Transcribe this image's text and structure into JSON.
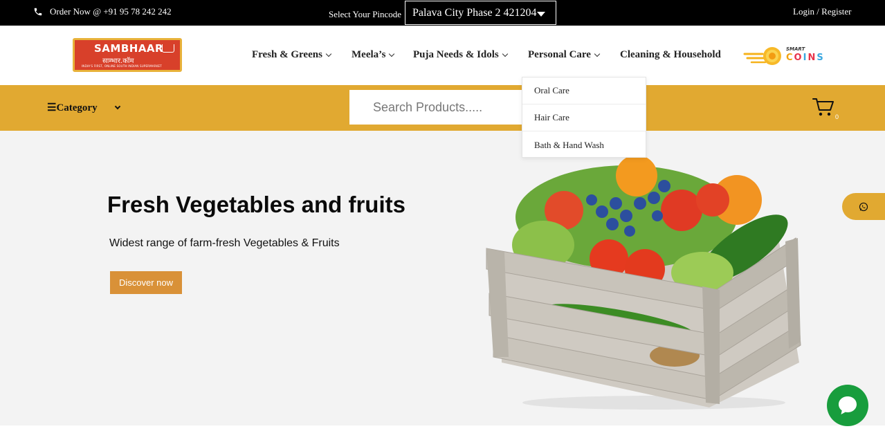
{
  "topbar": {
    "order_text": "Order Now @ +91 95 78 242 242",
    "pincode_label": "Select Your Pincode",
    "pincode_value": "Palava City Phase 2 421204",
    "login_text": "Login / Register"
  },
  "logo": {
    "name": "SAMBHAAR",
    "hindi": "साम्भार.कॉम",
    "tagline": "INDIA'S FIRST, ONLINE SOUTH INDIAN SUPERMARKET"
  },
  "nav": {
    "items": [
      {
        "label": "Fresh & Greens"
      },
      {
        "label": "Meela’s"
      },
      {
        "label": "Puja Needs & Idols"
      },
      {
        "label": "Personal Care"
      },
      {
        "label": "Cleaning & Household"
      }
    ]
  },
  "coins": {
    "smart": "SMART",
    "word": [
      "C",
      "O",
      "I",
      "N",
      "S"
    ]
  },
  "category_bar": {
    "category_label": "☰Category",
    "search_placeholder": "Search Products.....",
    "cart_count": "0"
  },
  "dropdown": {
    "items": [
      {
        "label": "Oral Care"
      },
      {
        "label": "Hair Care"
      },
      {
        "label": "Bath & Hand Wash"
      }
    ]
  },
  "hero": {
    "title": "Fresh Vegetables and fruits",
    "subtitle": "Widest range of farm-fresh Vegetables & Fruits",
    "button_label": "Discover now"
  },
  "colors": {
    "accent_yellow": "#e1a931",
    "button_orange": "#d99138",
    "logo_red": "#d8402a",
    "chat_green": "#189d3d"
  }
}
